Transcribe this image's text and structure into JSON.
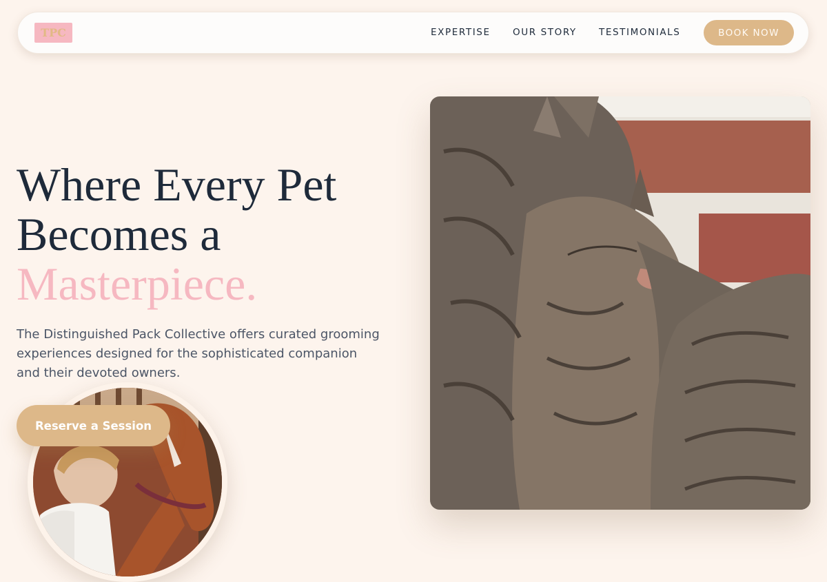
{
  "nav": {
    "logo_text": "TPC",
    "links": [
      "EXPERTISE",
      "OUR STORY",
      "TESTIMONIALS"
    ],
    "book_label": "BOOK NOW"
  },
  "hero": {
    "headline_line1": "Where Every Pet",
    "headline_line2": "Becomes a",
    "headline_accent": "Masterpiece.",
    "description": "The Distinguished Pack Collective offers curated grooming experiences designed for the sophisticated companion and their devoted owners.",
    "cta_label": "Reserve a Session"
  },
  "images": {
    "main_photo": "two-tabby-cats-cuddling-photo",
    "circle_photo": "woman-with-horse-photo",
    "watermark": "dapperanimal.com"
  },
  "colors": {
    "background": "#fdf4ed",
    "accent_pink": "#f6b8c1",
    "accent_gold": "#ddb889",
    "text_dark": "#1e2a3a"
  }
}
